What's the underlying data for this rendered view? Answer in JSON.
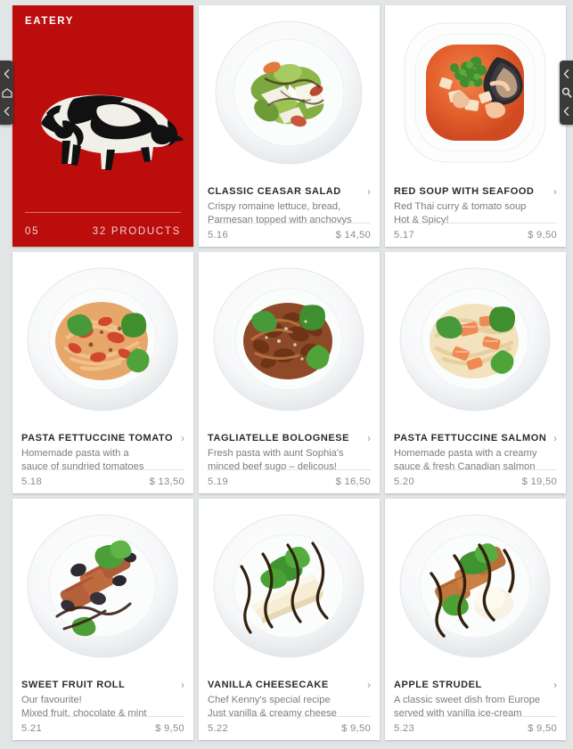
{
  "hero": {
    "brand": "EATERY",
    "number": "05",
    "count": "32 PRODUCTS",
    "accent_color": "#bc0d0d",
    "illustration_icon": "pig-illustration"
  },
  "edge_nav": {
    "left": {
      "top_icon": "chevron-left-icon",
      "middle_icon": "home-icon",
      "bottom_icon": "chevron-left-icon"
    },
    "right": {
      "top_icon": "chevron-left-icon",
      "middle_icon": "search-icon",
      "bottom_icon": "chevron-left-icon"
    }
  },
  "products": [
    {
      "title": "CLASSIC CEASAR SALAD",
      "desc_line1": "Crispy romaine lettuce, bread,",
      "desc_line2": "Parmesan topped with anchovys",
      "code": "5.16",
      "price": "$ 14,50",
      "chevron_icon": "chevron-right-icon",
      "photo": "salad"
    },
    {
      "title": "RED SOUP WITH SEAFOOD",
      "desc_line1": "Red Thai curry & tomato soup",
      "desc_line2": "Hot & Spicy!",
      "code": "5.17",
      "price": "$ 9,50",
      "chevron_icon": "chevron-right-icon",
      "photo": "soup"
    },
    {
      "title": "PASTA FETTUCCINE TOMATO",
      "desc_line1": "Homemade pasta with a",
      "desc_line2": "sauce of sundried tomatoes",
      "code": "5.18",
      "price": "$ 13,50",
      "chevron_icon": "chevron-right-icon",
      "photo": "pasta-tomato"
    },
    {
      "title": "TAGLIATELLE BOLOGNESE",
      "desc_line1": "Fresh pasta with aunt Sophia's",
      "desc_line2": "minced beef sugo – delicous!",
      "code": "5.19",
      "price": "$ 16,50",
      "chevron_icon": "chevron-right-icon",
      "photo": "bolognese"
    },
    {
      "title": "PASTA FETTUCCINE SALMON",
      "desc_line1": "Homemade pasta with a creamy",
      "desc_line2": "sauce & fresh Canadian salmon",
      "code": "5.20",
      "price": "$ 19,50",
      "chevron_icon": "chevron-right-icon",
      "photo": "pasta-salmon"
    },
    {
      "title": "SWEET FRUIT ROLL",
      "desc_line1": "Our favourite!",
      "desc_line2": "Mixed fruit, chocolate & mint",
      "code": "5.21",
      "price": "$ 9,50",
      "chevron_icon": "chevron-right-icon",
      "photo": "fruit-roll"
    },
    {
      "title": "VANILLA CHEESECAKE",
      "desc_line1": "Chef Kenny's special recipe",
      "desc_line2": "Just vanilla & creamy cheese",
      "code": "5.22",
      "price": "$ 9,50",
      "chevron_icon": "chevron-right-icon",
      "photo": "cheesecake"
    },
    {
      "title": "APPLE STRUDEL",
      "desc_line1": "A classic sweet dish from Europe",
      "desc_line2": "served with vanilla ice-cream",
      "code": "5.23",
      "price": "$ 9,50",
      "chevron_icon": "chevron-right-icon",
      "photo": "strudel"
    }
  ]
}
